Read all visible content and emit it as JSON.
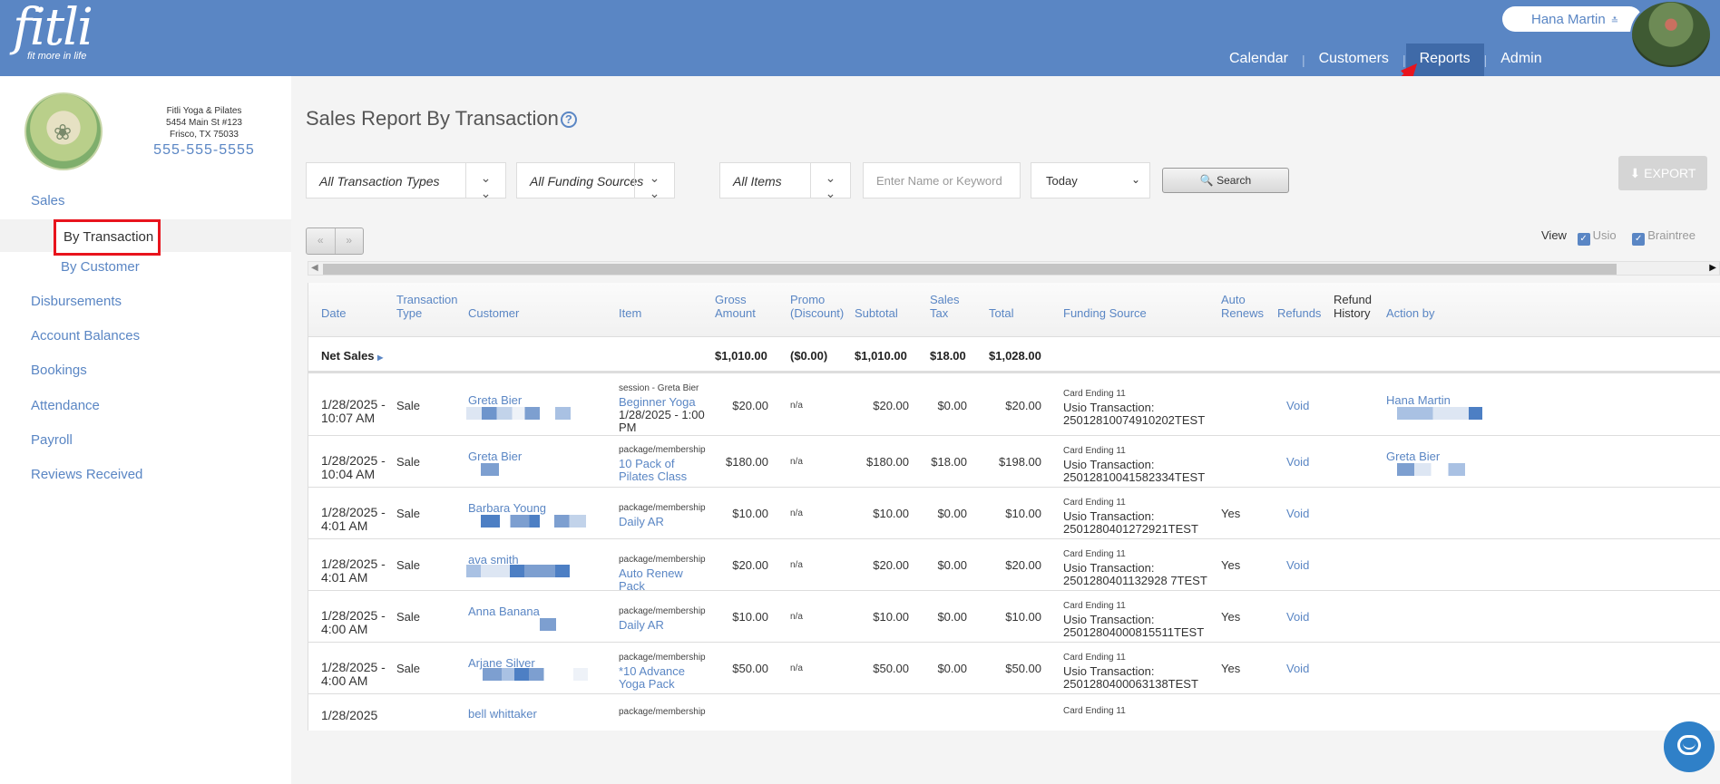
{
  "header": {
    "logo_word": "fitli",
    "logo_tagline": "fit more in life",
    "user_name": "Hana Martin",
    "nav": [
      {
        "label": "Calendar",
        "active": false
      },
      {
        "label": "Customers",
        "active": false
      },
      {
        "label": "Reports",
        "active": true
      },
      {
        "label": "Admin",
        "active": false
      }
    ]
  },
  "studio": {
    "name": "Fitli Yoga & Pilates",
    "address1": "5454 Main St #123",
    "address2": "Frisco, TX 75033",
    "phone": "555-555-5555"
  },
  "sidebar": {
    "sales": "Sales",
    "by_transaction": "By Transaction",
    "by_customer": "By Customer",
    "links": [
      "Disbursements",
      "Account Balances",
      "Bookings",
      "Attendance",
      "Payroll",
      "Reviews Received"
    ]
  },
  "page": {
    "title": "Sales Report By Transaction",
    "help_glyph": "?"
  },
  "filters": {
    "transaction_types": "All Transaction Types",
    "funding_sources": "All Funding Sources",
    "items": "All Items",
    "keyword_placeholder": "Enter Name or Keyword",
    "date_range": "Today",
    "search_label": "Search",
    "export_label": "EXPORT"
  },
  "pager": {
    "prev": "«",
    "next": "»"
  },
  "view": {
    "label": "View",
    "options": [
      {
        "label": "Usio",
        "checked": true
      },
      {
        "label": "Braintree",
        "checked": true
      }
    ]
  },
  "table": {
    "columns": [
      "Date",
      "Transaction Type",
      "Customer",
      "Item",
      "Gross Amount",
      "Promo (Discount)",
      "Subtotal",
      "Sales Tax",
      "Total",
      "Funding Source",
      "Auto Renews",
      "Refunds",
      "Refund History",
      "Action by"
    ],
    "net_sales": {
      "label": "Net Sales",
      "gross": "$1,010.00",
      "promo": "($0.00)",
      "subtotal": "$1,010.00",
      "tax": "$18.00",
      "total": "$1,028.00"
    },
    "rows": [
      {
        "date": "1/28/2025 - 10:07 AM",
        "type": "Sale",
        "customer": "Greta Bier",
        "item_cat": "session - Greta Bier",
        "item_name": "Beginner Yoga",
        "item_date": "1/28/2025 - 1:00 PM",
        "gross": "$20.00",
        "promo": "n/a",
        "subtotal": "$20.00",
        "tax": "$0.00",
        "total": "$20.00",
        "card": "Card Ending 11",
        "txn_line": "Usio Transaction:",
        "txn_id": "25012810074910202TEST",
        "auto_renews": "",
        "refund": "Void",
        "action_by": "Hana Martin"
      },
      {
        "date": "1/28/2025 - 10:04 AM",
        "type": "Sale",
        "customer": "Greta Bier",
        "item_cat": "package/membership",
        "item_name": "10 Pack of Pilates Class",
        "item_date": "",
        "gross": "$180.00",
        "promo": "n/a",
        "subtotal": "$180.00",
        "tax": "$18.00",
        "total": "$198.00",
        "card": "Card Ending 11",
        "txn_line": "Usio Transaction:",
        "txn_id": "25012810041582334TEST",
        "auto_renews": "",
        "refund": "Void",
        "action_by": "Greta Bier"
      },
      {
        "date": "1/28/2025 - 4:01 AM",
        "type": "Sale",
        "customer": "Barbara Young",
        "item_cat": "package/membership",
        "item_name": "Daily AR",
        "item_date": "",
        "gross": "$10.00",
        "promo": "n/a",
        "subtotal": "$10.00",
        "tax": "$0.00",
        "total": "$10.00",
        "card": "Card Ending 11",
        "txn_line": "Usio Transaction:",
        "txn_id": "2501280401272921TEST",
        "auto_renews": "Yes",
        "refund": "Void",
        "action_by": ""
      },
      {
        "date": "1/28/2025 - 4:01 AM",
        "type": "Sale",
        "customer": "ava smith",
        "item_cat": "package/membership",
        "item_name": "Auto Renew Pack",
        "item_date": "",
        "gross": "$20.00",
        "promo": "n/a",
        "subtotal": "$20.00",
        "tax": "$0.00",
        "total": "$20.00",
        "card": "Card Ending 11",
        "txn_line": "Usio Transaction:",
        "txn_id": "2501280401132928 7TEST",
        "auto_renews": "Yes",
        "refund": "Void",
        "action_by": ""
      },
      {
        "date": "1/28/2025 - 4:00 AM",
        "type": "Sale",
        "customer": "Anna Banana",
        "item_cat": "package/membership",
        "item_name": "Daily AR",
        "item_date": "",
        "gross": "$10.00",
        "promo": "n/a",
        "subtotal": "$10.00",
        "tax": "$0.00",
        "total": "$10.00",
        "card": "Card Ending 11",
        "txn_line": "Usio Transaction:",
        "txn_id": "25012804000815511TEST",
        "auto_renews": "Yes",
        "refund": "Void",
        "action_by": ""
      },
      {
        "date": "1/28/2025 - 4:00 AM",
        "type": "Sale",
        "customer": "Arjane Silver",
        "item_cat": "package/membership",
        "item_name": "*10 Advance Yoga Pack",
        "item_date": "",
        "gross": "$50.00",
        "promo": "n/a",
        "subtotal": "$50.00",
        "tax": "$0.00",
        "total": "$50.00",
        "card": "Card Ending 11",
        "txn_line": "Usio Transaction:",
        "txn_id": "2501280400063138TEST",
        "auto_renews": "Yes",
        "refund": "Void",
        "action_by": ""
      },
      {
        "date": "1/28/2025",
        "type": "",
        "customer": "bell whittaker",
        "item_cat": "package/membership",
        "item_name": "",
        "item_date": "",
        "gross": "",
        "promo": "",
        "subtotal": "",
        "tax": "",
        "total": "",
        "card": "Card Ending 11",
        "txn_line": "",
        "txn_id": "",
        "auto_renews": "",
        "refund": "",
        "action_by": ""
      }
    ]
  }
}
